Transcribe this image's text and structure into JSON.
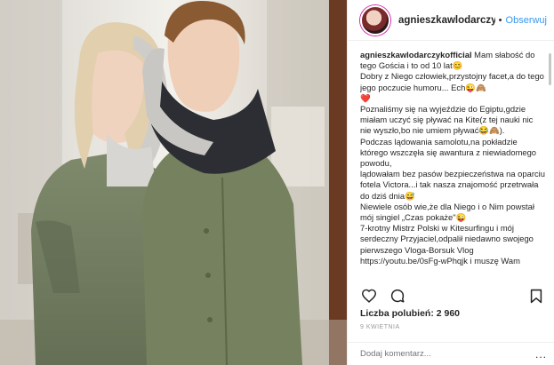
{
  "post": {
    "username": "agnieszkawlodarczykoff...",
    "dot": "•",
    "follow_label": "Obserwuj",
    "caption": {
      "author": "agnieszkawlodarczykofficial",
      "lines": [
        " Mam słabość do tego Gościa i to od 10 lat😊",
        "Dobry z Niego człowiek,przystojny facet,a do tego jego poczucie humoru... Ech😜🙈",
        "❤️",
        "Poznaliśmy się na wyjeździe do Egiptu,gdzie miałam uczyć się pływać na Kite(z tej nauki nic nie wyszło,bo nie umiem pływać😂🙈).",
        "Podczas lądowania samolotu,na pokładzie którego wszczęła się awantura z niewiadomego powodu,",
        "lądowałam bez pasów bezpieczeństwa na oparciu fotela Victora...i tak nasza znajomość przetrwała do dziś dnia😅",
        "Niewiele osób wie,że dla Niego i o Nim powstał mój singiel „Czas pokaże\"😜",
        "7-krotny Mistrz Polski w Kitesurfingu i mój serdeczny Przyjaciel,odpalił niedawno swojego pierwszego Vloga-Borsuk Vlog",
        "https://youtu.be/0sFg-wPhqjk i muszę Wam"
      ]
    },
    "likes_text": "Liczba polubień: 2 960",
    "date": "9 kwietnia",
    "comment_placeholder": "Dodaj komentarz...",
    "more_label": "..."
  },
  "icons": {
    "like": "heart-icon",
    "comment": "comment-icon",
    "save": "bookmark-icon"
  },
  "colors": {
    "accent": "#3897f0",
    "text": "#262626",
    "muted": "#999999",
    "border": "#efefef"
  }
}
